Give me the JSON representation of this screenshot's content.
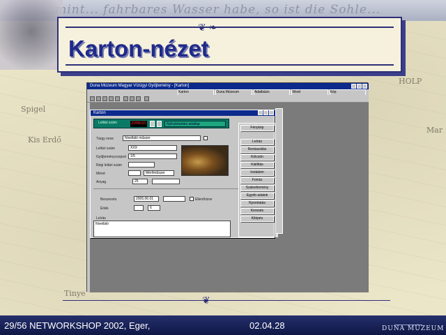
{
  "slide": {
    "header_script": "...mint... fahrbares Wasser habe, so ist die Sohle...",
    "title": "Karton-nézet",
    "map_labels": [
      "Spigel",
      "Kis Erdő",
      "Tinye",
      "HOLP",
      "Mar"
    ],
    "footer_left": "29/56 NETWORKSHOP 2002, Eger,",
    "footer_date": "02.04.28",
    "footer_brand": "DUNA MÚZEUM"
  },
  "app": {
    "window_title": "Duna Múzeum Magyar Vízügyi Gyűjtemény - [Karton]",
    "taskbar_items": [
      "Karton",
      "Duna Múzeum",
      "Adatbázis",
      "Word",
      "Kép"
    ]
  },
  "form": {
    "title": "Karton",
    "inventory_label": "Leltári szám",
    "inventory_value": "2006/20",
    "record_label": "Nyilvántartási adatlap",
    "fields": [
      {
        "label": "Tárgy neve",
        "value": "Nivelláló műszer"
      },
      {
        "label": "Leltári szám",
        "value": "XXX"
      },
      {
        "label": "Gyűjteménycsoport",
        "value": "1/5"
      },
      {
        "label": "Régi leltári szám",
        "value": ""
      },
      {
        "label": "Méret",
        "value": "Mérőműszer"
      },
      {
        "label": "Anyag",
        "value": "25"
      },
      {
        "label": "Beszerzés",
        "value": "2005.06.01"
      },
      {
        "label": "Érték",
        "value": "6"
      }
    ],
    "checkbox_label": "Ellenőrizve",
    "photo_label": "Fénykép",
    "memo_label": "Leírás",
    "memo_value": "Nivelláló"
  },
  "side_buttons": [
    "Fénykép",
    "Leírás",
    "Restaurálás",
    "Kölcsön",
    "Kiállítás",
    "Irodalom",
    "Forrás",
    "Szakvélemény",
    "Egyéb adatok",
    "Nyomtatás",
    "Keresés",
    "Kilépés"
  ],
  "colors": {
    "title": "#1f2a8a",
    "panel_border": "#2d2f78",
    "app_title": "#0c2a8c",
    "green_bar": "#0a7a66",
    "footer": "#1a2358"
  }
}
